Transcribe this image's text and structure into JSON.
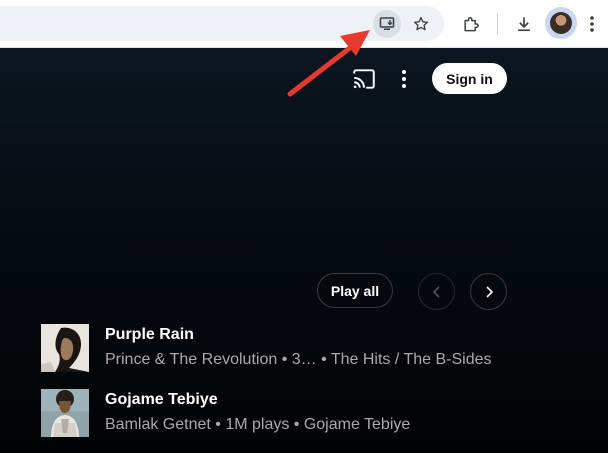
{
  "browser": {
    "icons": {
      "install": "install-app-icon",
      "bookmark": "star-icon",
      "extensions": "puzzle-icon",
      "downloads": "download-icon",
      "profile": "avatar",
      "menu": "more-vert-icon"
    }
  },
  "header": {
    "cast_icon": "cast-icon",
    "more_icon": "more-vert-icon",
    "sign_in_label": "Sign in"
  },
  "controls": {
    "play_all_label": "Play all",
    "prev_icon": "chevron-left-icon",
    "next_icon": "chevron-right-icon"
  },
  "songs": [
    {
      "title": "Purple Rain",
      "subtitle": "Prince & The Revolution • 3… • The Hits / The B-Sides"
    },
    {
      "title": "Gojame Tebiye",
      "subtitle": "Bamlak Getnet • 1M plays • Gojame Tebiye"
    }
  ],
  "annotation": {
    "color": "#e8392f"
  }
}
